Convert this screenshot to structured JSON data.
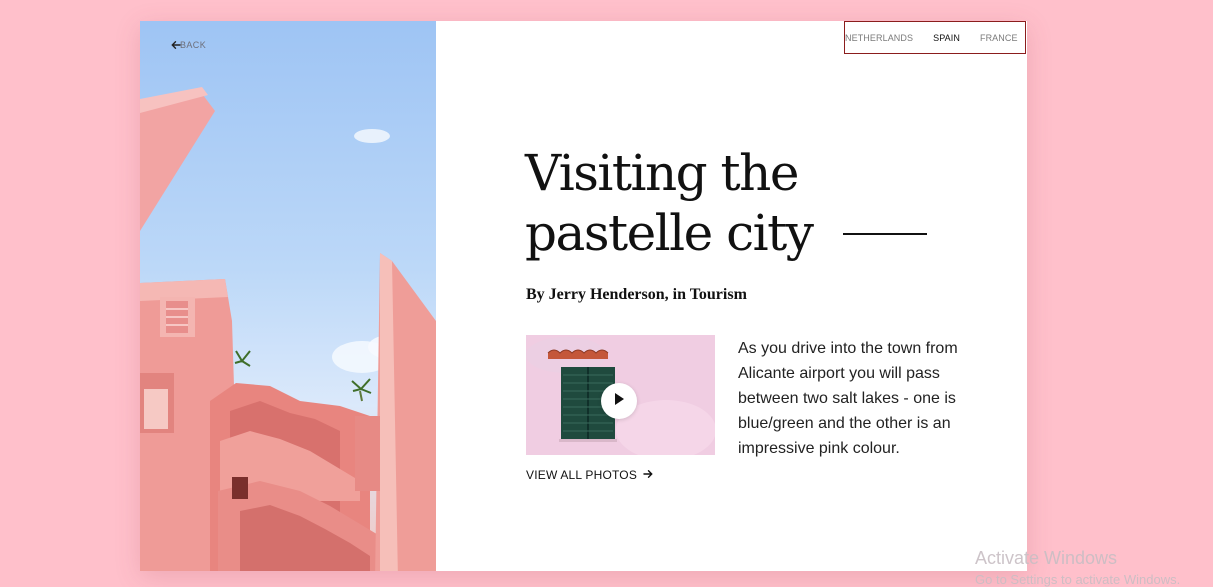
{
  "nav": {
    "back_label": "BACK",
    "countries": [
      "NETHERLANDS",
      "SPAIN",
      "FRANCE"
    ],
    "active": "SPAIN"
  },
  "article": {
    "title_line1": "Visiting the",
    "title_line2": "pastelle city",
    "byline": "By Jerry Henderson, in Tourism",
    "body": "As you drive into the town from Alicante airport you will pass between two salt lakes - one is blue/green and the other is an impressive pink colour.",
    "view_all_label": "VIEW ALL PHOTOS"
  },
  "system": {
    "watermark_title": "Activate Windows",
    "watermark_sub": "Go to Settings to activate Windows."
  },
  "colors": {
    "page_background": "#ffc0cb",
    "card_background": "#ffffff",
    "nav_border": "#8b1d1d",
    "text_primary": "#111111"
  },
  "icons": {
    "back": "arrow-left-icon",
    "view_all": "arrow-right-icon",
    "video": "play-icon"
  }
}
